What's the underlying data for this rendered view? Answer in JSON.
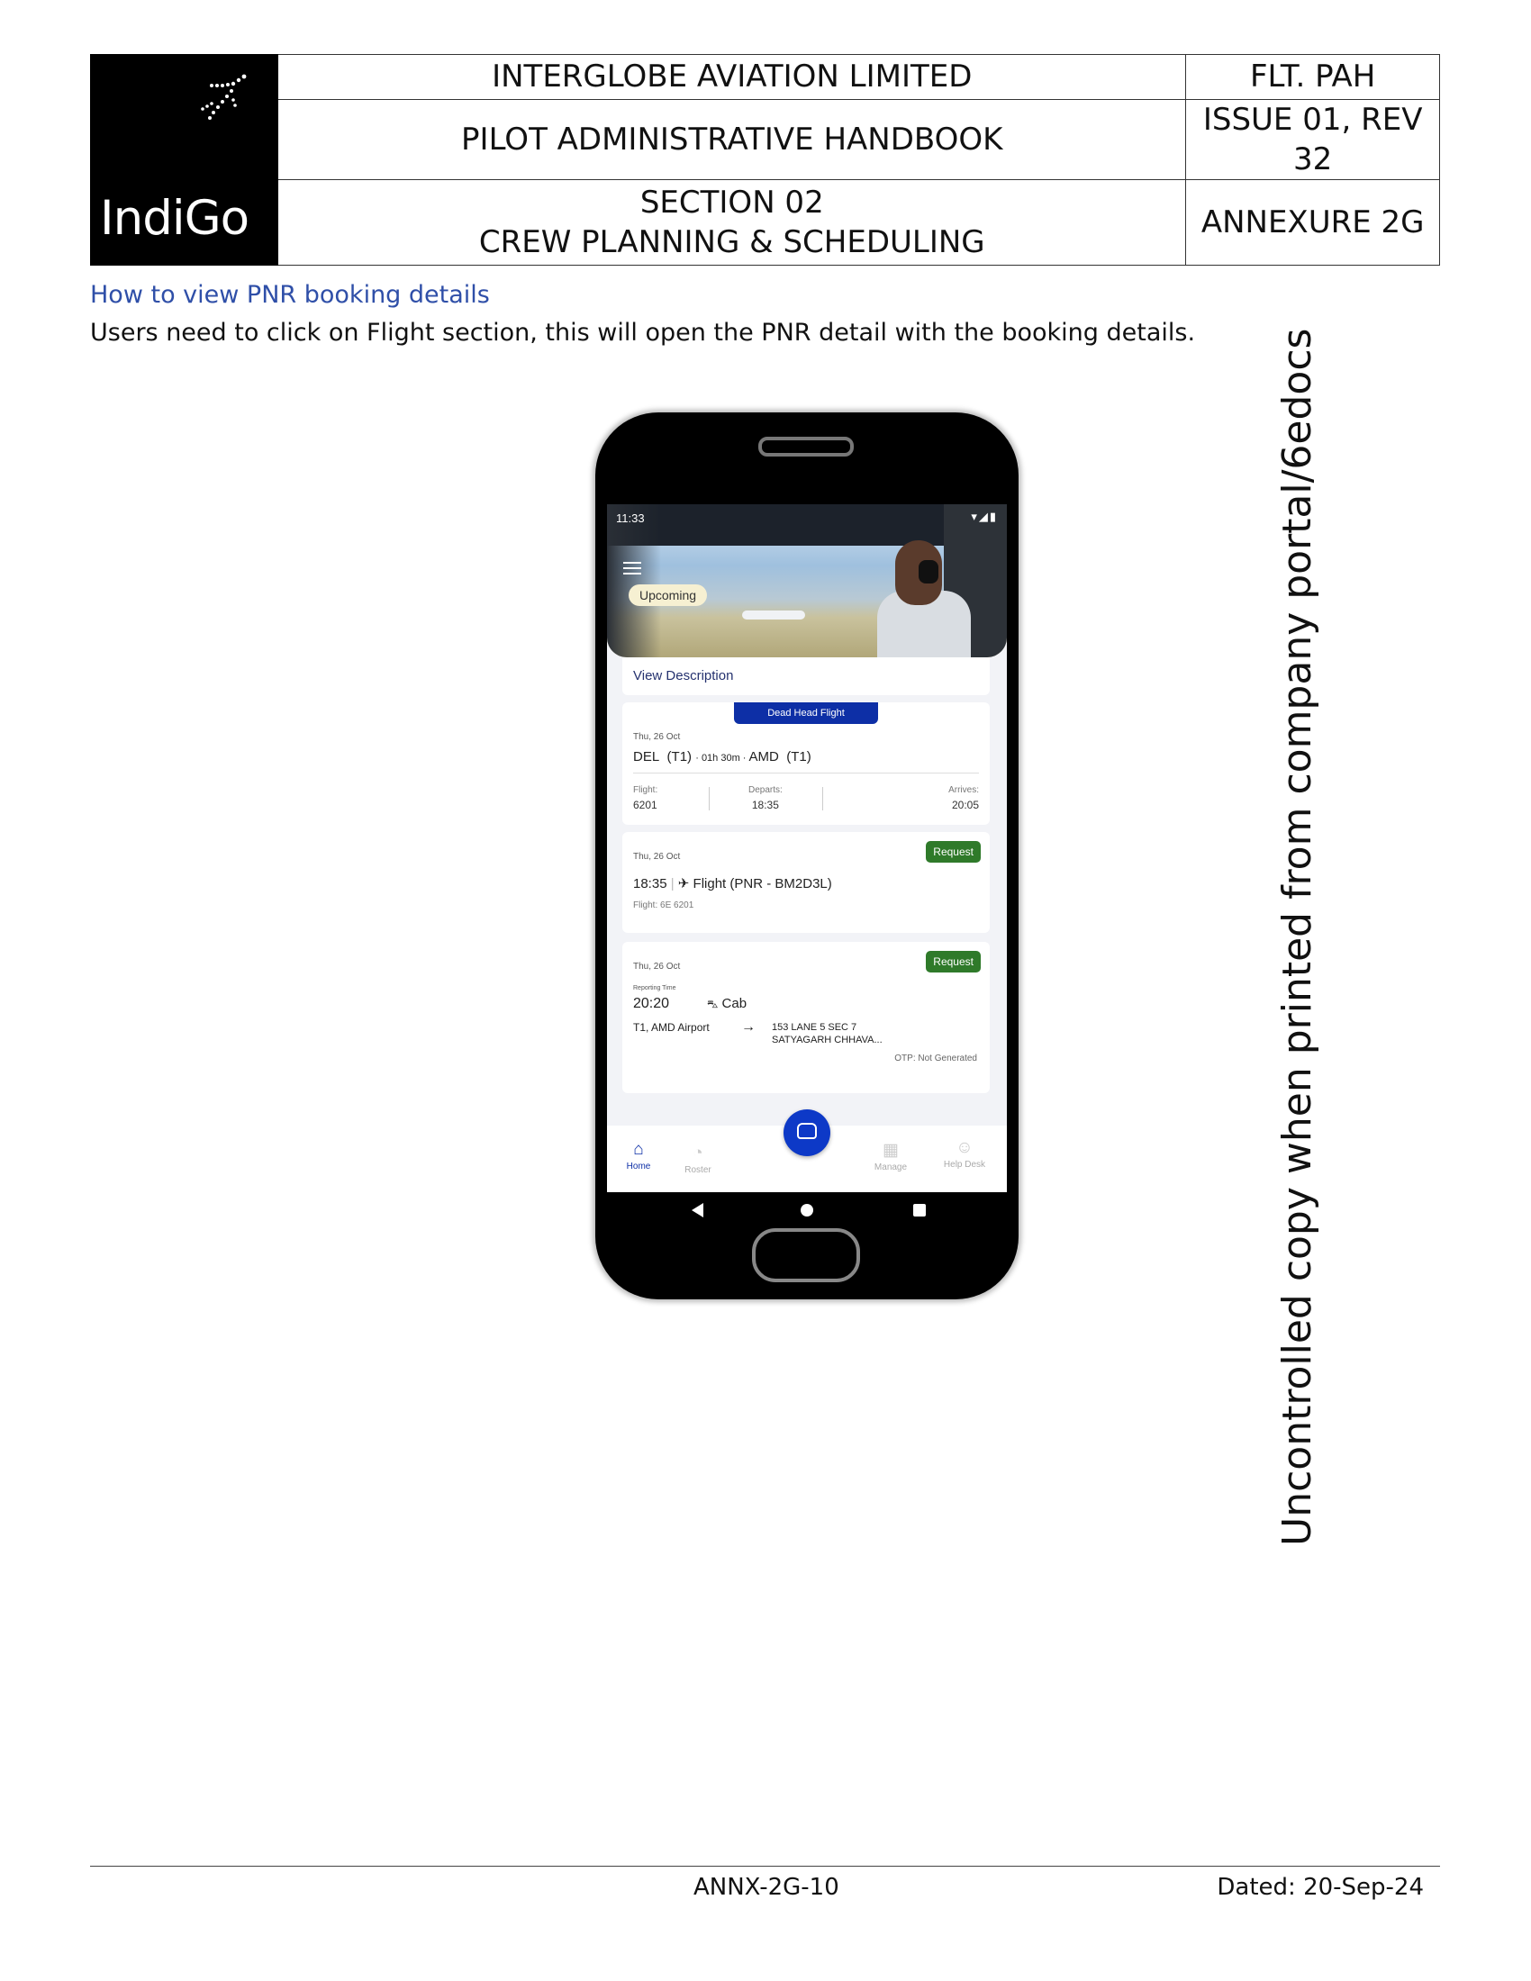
{
  "header": {
    "company": "INTERGLOBE AVIATION LIMITED",
    "manual": "PILOT ADMINISTRATIVE HANDBOOK",
    "section_line1": "SECTION 02",
    "section_line2": "CREW PLANNING & SCHEDULING",
    "doc_code": "FLT. PAH",
    "issue": "ISSUE 01, REV 32",
    "annexure": "ANNEXURE 2G",
    "logo_text": "IndiGo",
    "logo_icon": "plane-dots-icon"
  },
  "body": {
    "subheading": "How to view PNR booking details",
    "instruction": "Users need to click on Flight section, this will open the PNR detail with the booking details."
  },
  "phone_screen": {
    "status_time": "11:33",
    "hero_tag": "Upcoming",
    "view_description": "View Description",
    "deadhead": {
      "badge": "Dead Head Flight",
      "date": "Thu, 26 Oct",
      "from": "DEL",
      "from_terminal": "(T1)",
      "duration": "01h 30m",
      "to": "AMD",
      "to_terminal": "(T1)",
      "flight_label": "Flight:",
      "flight_value": "6201",
      "departs_label": "Departs:",
      "departs_value": "18:35",
      "arrives_label": "Arrives:",
      "arrives_value": "20:05"
    },
    "flight_card": {
      "date": "Thu, 26 Oct",
      "request": "Request",
      "time": "18:35",
      "title": "Flight (PNR - BM2D3L)",
      "sub": "Flight: 6E 6201"
    },
    "cab_card": {
      "date": "Thu, 26 Oct",
      "request": "Request",
      "reporting_label": "Reporting Time",
      "time": "20:20",
      "mode": "Cab",
      "from": "T1, AMD Airport",
      "to_line1": "153 LANE 5 SEC 7",
      "to_line2": "SATYAGARH CHHAVA...",
      "otp": "OTP: Not Generated"
    },
    "nav": {
      "home": "Home",
      "roster": "Roster",
      "manage": "Manage",
      "help": "Help Desk"
    }
  },
  "watermark": "Uncontrolled copy when printed from company portal/6edocs",
  "footer": {
    "page_ref": "ANNX-2G-10",
    "dated": "Dated: 20-Sep-24"
  },
  "colors": {
    "subheading": "#2f4fa8",
    "brand_blue": "#0d2fa6",
    "request_green": "#2f7a2a"
  }
}
